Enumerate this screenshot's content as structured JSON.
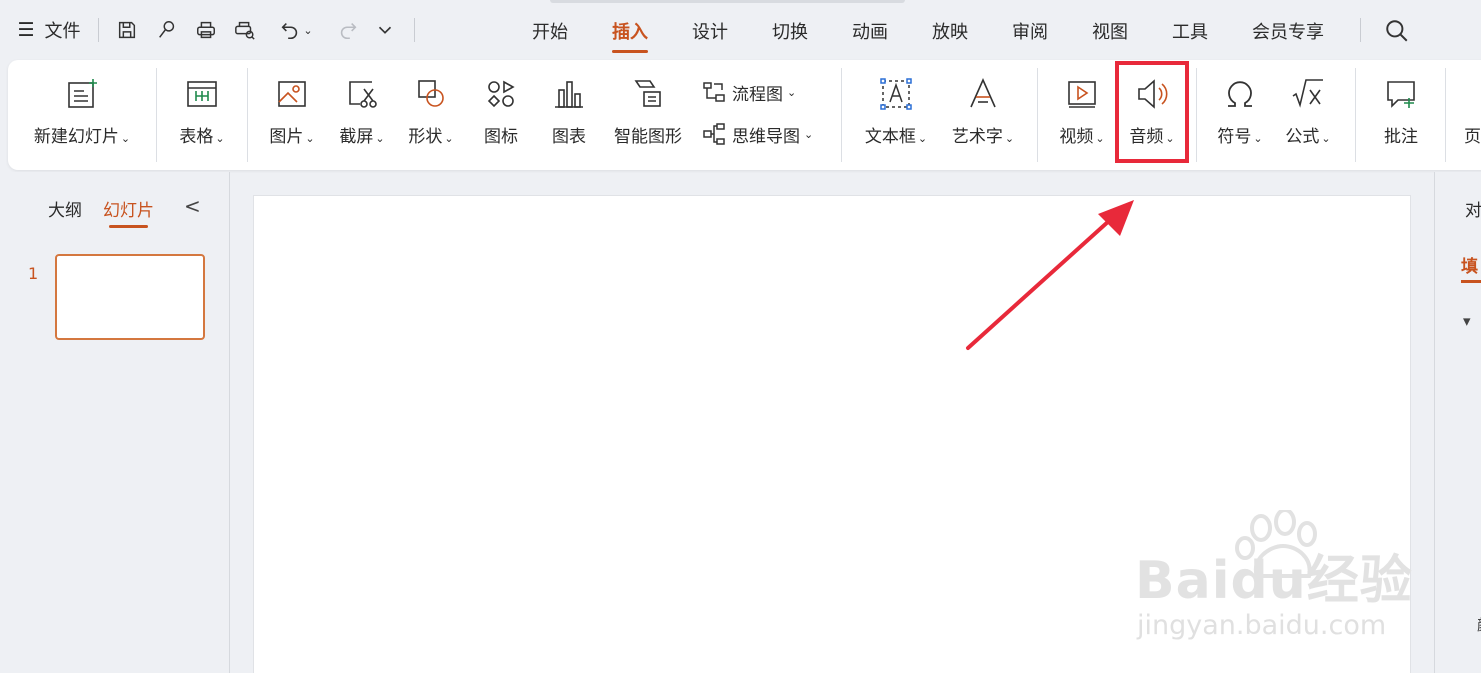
{
  "quick_access": {
    "file_label": "文件",
    "icons": [
      "save-icon",
      "format-painter-icon",
      "print-icon",
      "print-preview-icon",
      "undo-icon",
      "redo-icon",
      "more-icon"
    ]
  },
  "tabs": [
    {
      "label": "开始",
      "active": false
    },
    {
      "label": "插入",
      "active": true
    },
    {
      "label": "设计",
      "active": false
    },
    {
      "label": "切换",
      "active": false
    },
    {
      "label": "动画",
      "active": false
    },
    {
      "label": "放映",
      "active": false
    },
    {
      "label": "审阅",
      "active": false
    },
    {
      "label": "视图",
      "active": false
    },
    {
      "label": "工具",
      "active": false
    },
    {
      "label": "会员专享",
      "active": false
    }
  ],
  "ribbon": {
    "new_slide": "新建幻灯片",
    "table": "表格",
    "picture": "图片",
    "screenshot": "截屏",
    "shape": "形状",
    "icon": "图标",
    "chart": "图表",
    "smart_art": "智能图形",
    "flowchart": "流程图",
    "mindmap": "思维导图",
    "textbox": "文本框",
    "wordart": "艺术字",
    "video": "视频",
    "audio": "音频",
    "symbol": "符号",
    "formula": "公式",
    "comment": "批注",
    "page_partial": "页"
  },
  "left_panel": {
    "tab_outline": "大纲",
    "tab_slides": "幻灯片",
    "collapse_glyph": "<",
    "slides": [
      {
        "number": "1"
      }
    ]
  },
  "right_panel": {
    "text1": "对",
    "text2": "填",
    "text3": "▾",
    "text4": "颜"
  },
  "watermark": {
    "brand": "Baidu经验",
    "url": "jingyan.baidu.com"
  },
  "colors": {
    "accent": "#c8531f",
    "highlight": "#e8293a",
    "icon_green": "#1f8a4c"
  }
}
